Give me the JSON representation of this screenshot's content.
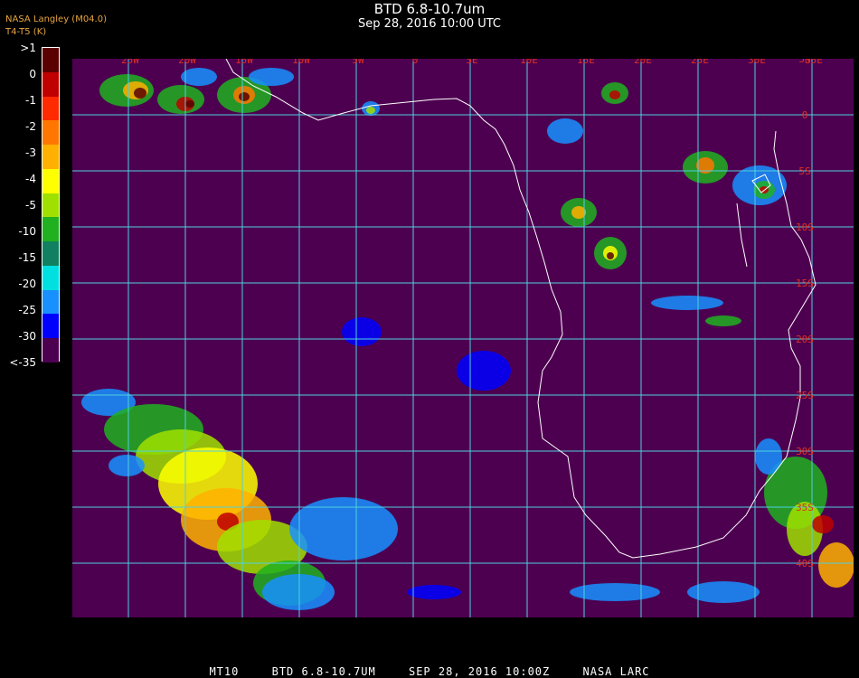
{
  "header": {
    "title": "BTD 6.8-10.7um",
    "subtitle": "Sep 28, 2016 10:00 UTC",
    "corner_line1": "NASA Langley (M04.0)",
    "corner_line2": "T4-T5 (K)"
  },
  "colorbar": {
    "labels": [
      ">1",
      "0",
      "-1",
      "-2",
      "-3",
      "-4",
      "-5",
      "-10",
      "-15",
      "-20",
      "-25",
      "-30",
      "<-35"
    ],
    "colors": [
      "#5a0000",
      "#c00000",
      "#ff2a00",
      "#ff7700",
      "#ffb000",
      "#ffff00",
      "#a0e000",
      "#20b020",
      "#108060",
      "#00e0e0",
      "#1890ff",
      "#0000ff",
      "#4d0050"
    ]
  },
  "map": {
    "background": "#4d0050",
    "grid_color": "#4fd0e0",
    "coast_color": "#ffffff",
    "label_color": "#e03020",
    "lon_labels": [
      "25W",
      "20W",
      "15W",
      "10W",
      "5W",
      "0",
      "5E",
      "10E",
      "15E",
      "20E",
      "25E",
      "30E",
      "35E"
    ],
    "lat_labels": [
      "5N",
      "0",
      "5S",
      "10S",
      "15S",
      "20S",
      "25S",
      "30S",
      "35S",
      "40S"
    ]
  },
  "footer": {
    "satellite": "MT10",
    "product": "BTD 6.8-10.7UM",
    "datetime": "SEP 28, 2016 10:00Z",
    "source": "NASA LARC"
  }
}
